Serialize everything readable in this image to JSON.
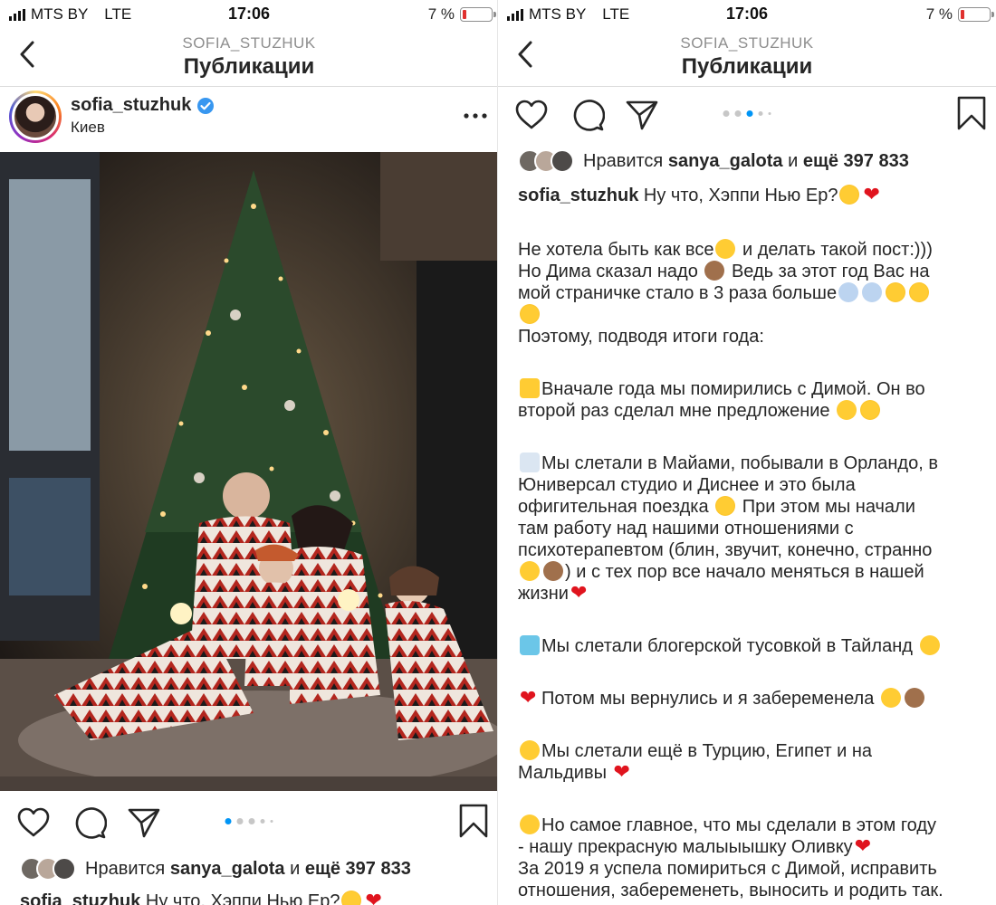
{
  "status": {
    "carrier": "MTS BY",
    "network": "LTE",
    "time": "17:06",
    "battery_text": "7 %",
    "battery_level": 0.07
  },
  "nav": {
    "username_upper": "SOFIA_STUZHUK",
    "title": "Публикации"
  },
  "post": {
    "username": "sofia_stuzhuk",
    "location": "Киев"
  },
  "carousel": {
    "count": 5,
    "active_index": 0,
    "right_active_index": 2
  },
  "likes": {
    "prefix": "Нравится",
    "user": "sanya_galota",
    "middle": "и",
    "count": "ещё 397 833"
  },
  "caption": {
    "username": "sofia_stuzhuk",
    "first_line": "Ну что, Хэппи Нью Ер?",
    "para1_a": "Не хотела быть как все",
    "para1_b": " и делать такой пост:)))",
    "para1_c": "Но Дима сказал надо ",
    "para1_d": " Ведь за этот год Вас на",
    "para1_e": "мой страничке стало в 3 раза больше",
    "para1_f": "Поэтому, подводя итоги года:",
    "para2_a": "Вначале года мы помирились с Димой. Он во",
    "para2_b": "второй раз сделал мне предложение ",
    "para3_a": "Мы слетали в Майами, побывали в Орландо, в",
    "para3_b": "Юниверсал студио и Диснее и это была",
    "para3_c": "офигительная поездка ",
    "para3_d": " При этом мы начали",
    "para3_e": "там работу над нашими отношениями с",
    "para3_f": "психотерапевтом (блин, звучит, конечно, странно",
    "para3_g": ") и с тех пор все начало меняться в нашей",
    "para3_h": "жизни",
    "para4": "Мы слетали блогерской тусовкой в Тайланд ",
    "para5": "Потом мы вернулись и я забеременела ",
    "para6_a": "Мы слетали ещё в Турцию, Египет и на",
    "para6_b": "Мальдивы ",
    "para7_a": "Но самое главное, что мы сделали в этом году",
    "para7_b": "- нашу прекрасную малыыышку Оливку",
    "para7_c": "За 2019 я успела помириться с Димой, исправить",
    "para7_d": "отношения, забеременеть, выносить и родить так."
  },
  "icons": {
    "back": "chevron-left-icon",
    "more": "more-horizontal-icon",
    "like": "heart-outline-icon",
    "comment": "comment-icon",
    "share": "paper-plane-icon",
    "save": "bookmark-icon",
    "verified": "verified-badge-icon"
  },
  "colors": {
    "accent": "#0095f6",
    "verified": "#3897f0",
    "heart": "#e0141e",
    "text": "#262626",
    "muted": "#8e8e8e"
  }
}
